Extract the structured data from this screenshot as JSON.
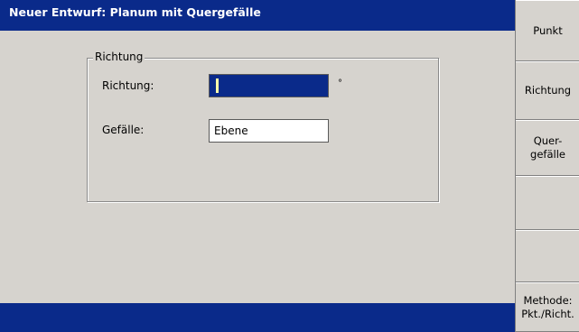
{
  "window": {
    "title": "Neuer Entwurf: Planum mit Quergefälle"
  },
  "form": {
    "group_title": "Richtung",
    "direction_label": "Richtung:",
    "direction_value": "",
    "direction_unit": "°",
    "slope_label": "Gefälle:",
    "slope_value": "Ebene"
  },
  "softkeys": [
    "Punkt",
    "Richtung",
    "Quer-\ngefälle",
    "",
    "",
    "Methode:\nPkt./Richt."
  ],
  "colors": {
    "titlebar": "#0a2a8a",
    "background": "#d6d3ce",
    "active_field": "#0a2a8a",
    "caret": "#ffffaa"
  }
}
